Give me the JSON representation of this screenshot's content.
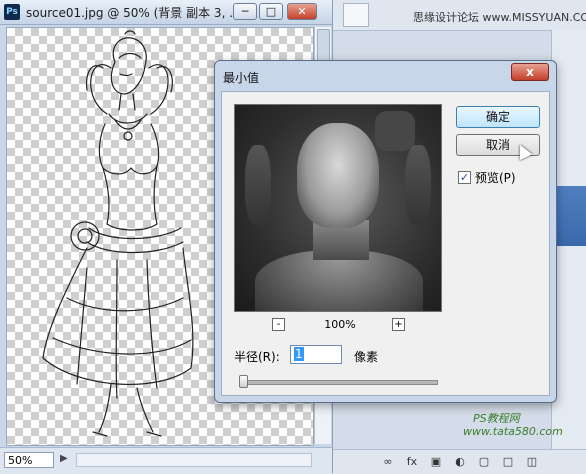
{
  "document": {
    "app_icon": "Ps",
    "title": "source01.jpg @ 50% (背景 副本 3, ...",
    "window_buttons": [
      "minimize",
      "maximize",
      "close"
    ],
    "zoom": "50%"
  },
  "panel": {
    "watermark_top": "思缘设计论坛 www.MISSYUAN.COM",
    "watermark_bottom": "www.tata580.com",
    "watermark_ps": "PS教程网"
  },
  "dialog": {
    "title": "最小值",
    "close_label": "x",
    "ok_label": "确定",
    "cancel_label": "取消",
    "preview_label": "预览(P)",
    "preview_checked": true,
    "zoom_minus": "-",
    "zoom_plus": "+",
    "zoom": "100%",
    "radius_label": "半径(R):",
    "radius_value": "1",
    "radius_unit": "像素"
  },
  "colors": {
    "ok_button": "#bee6fd",
    "close_button": "#c23f2a",
    "selection": "#3399ff"
  }
}
